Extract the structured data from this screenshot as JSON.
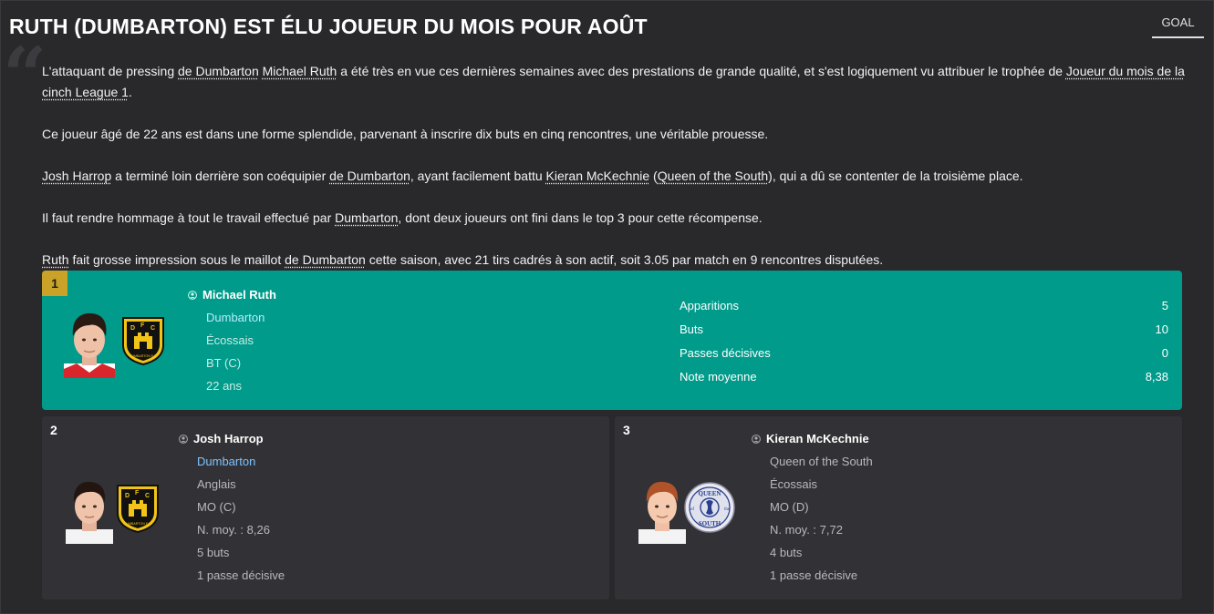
{
  "header": {
    "title": "RUTH (DUMBARTON) EST ÉLU JOUEUR DU MOIS POUR AOÛT",
    "source_tab": "GOAL"
  },
  "article": {
    "p1": {
      "t1": "L'attaquant de pressing ",
      "l1": "de Dumbarton",
      "t2": " ",
      "l2": "Michael Ruth",
      "t3": " a été très en vue ces dernières semaines avec des prestations de grande qualité, et s'est logiquement vu attribuer le trophée de ",
      "l3": "Joueur du mois de la cinch League 1",
      "t4": "."
    },
    "p2": "Ce joueur âgé de 22 ans est dans une forme splendide, parvenant à inscrire dix buts en cinq rencontres, une véritable prouesse.",
    "p3": {
      "l1": "Josh Harrop",
      "t1": " a terminé loin derrière son coéquipier ",
      "l2": "de Dumbarton",
      "t2": ", ayant facilement battu ",
      "l3": "Kieran McKechnie",
      "t3": " (",
      "l4": "Queen of the South",
      "t4": "), qui a dû se contenter de la troisième place."
    },
    "p4": {
      "t1": "Il faut rendre hommage à tout le travail effectué par ",
      "l1": "Dumbarton",
      "t2": ", dont deux joueurs ont fini dans le top 3 pour cette récompense."
    },
    "p5": {
      "l1": "Ruth",
      "t1": " fait grosse impression sous le maillot ",
      "l2": "de Dumbarton",
      "t2": " cette saison, avec 21 tirs cadrés à son actif, soit 3.05 par match en 9 rencontres disputées."
    }
  },
  "winner": {
    "rank": "1",
    "name": "Michael Ruth",
    "club": "Dumbarton",
    "nationality": "Écossais",
    "position": "BT (C)",
    "age": "22 ans",
    "stats": [
      {
        "label": "Apparitions",
        "value": "5"
      },
      {
        "label": "Buts",
        "value": "10"
      },
      {
        "label": "Passes décisives",
        "value": "0"
      },
      {
        "label": "Note moyenne",
        "value": "8,38"
      }
    ]
  },
  "runners": [
    {
      "rank": "2",
      "name": "Josh Harrop",
      "club": "Dumbarton",
      "nationality": "Anglais",
      "position": "MO (C)",
      "rating": "N. moy. : 8,26",
      "goals": "5 buts",
      "assists": "1 passe décisive"
    },
    {
      "rank": "3",
      "name": "Kieran McKechnie",
      "club": "Queen of the South",
      "nationality": "Écossais",
      "position": "MO (D)",
      "rating": "N. moy. : 7,72",
      "goals": "4 buts",
      "assists": "1 passe décisive"
    }
  ],
  "colors": {
    "winner_bg": "#009b8a",
    "rank_gold": "#c9a227",
    "card_bg": "#323236",
    "club_link": "#7ec3ff"
  },
  "icons": {
    "person": "person-icon",
    "dumbarton_crest": "dumbarton-crest",
    "queen_of_the_south_crest": "queen-of-the-south-crest"
  },
  "crest_text": {
    "dumbarton": "DUMBARTON F.C.",
    "qos_top": "QUEEN",
    "qos_bottom": "SOUTH",
    "qos_left": "of",
    "qos_right": "the"
  }
}
